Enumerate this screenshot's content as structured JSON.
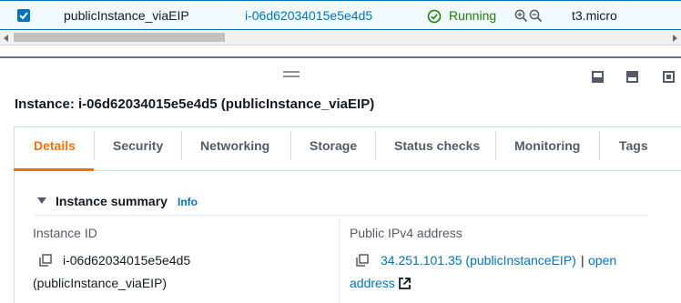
{
  "row": {
    "checked": true,
    "name": "publicInstance_viaEIP",
    "instance_id": "i-06d62034015e5e4d5",
    "status": "Running",
    "instance_type": "t3.micro"
  },
  "panel": {
    "title": "Instance: i-06d62034015e5e4d5 (publicInstance_viaEIP)"
  },
  "tabs": [
    {
      "label": "Details",
      "active": true
    },
    {
      "label": "Security"
    },
    {
      "label": "Networking"
    },
    {
      "label": "Storage"
    },
    {
      "label": "Status checks"
    },
    {
      "label": "Monitoring"
    },
    {
      "label": "Tags"
    }
  ],
  "summary": {
    "title": "Instance summary",
    "info": "Info",
    "instance_id_label": "Instance ID",
    "instance_id_value": "i-06d62034015e5e4d5",
    "instance_id_name": "(publicInstance_viaEIP)",
    "ipv4_label": "Public IPv4 address",
    "ipv4_value": "34.251.101.35 (publicInstanceEIP)",
    "separator": "|",
    "open_label": "open",
    "address_label": "address"
  },
  "colors": {
    "accent": "#0073bb",
    "active_tab": "#ec7211",
    "running": "#1d8102"
  }
}
